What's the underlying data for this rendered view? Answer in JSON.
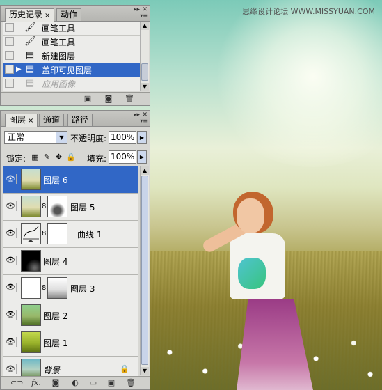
{
  "watermark": "思缘设计论坛 WWW.MISSYUAN.COM",
  "history_panel": {
    "tabs": [
      "历史记录",
      "动作"
    ],
    "close_glyph": "×",
    "items": [
      {
        "label": "画笔工具",
        "icon": "brush-icon",
        "state": "normal"
      },
      {
        "label": "画笔工具",
        "icon": "brush-icon",
        "state": "normal"
      },
      {
        "label": "新建图层",
        "icon": "document-icon",
        "state": "normal"
      },
      {
        "label": "盖印可见图层",
        "icon": "document-icon",
        "state": "selected"
      },
      {
        "label": "应用图像",
        "icon": "document-icon",
        "state": "dimmed"
      }
    ],
    "footer_icons": [
      "new-document-from-state-icon",
      "new-snapshot-icon",
      "trash-icon"
    ]
  },
  "layers_panel": {
    "tabs": [
      "图层",
      "通道",
      "路径"
    ],
    "blend_mode": "正常",
    "opacity_label": "不透明度:",
    "opacity_value": "100%",
    "lock_label": "锁定:",
    "fill_label": "填充:",
    "fill_value": "100%",
    "layers": [
      {
        "name": "图层 6",
        "selected": true,
        "thumb": "photo",
        "mask": null,
        "locked": false
      },
      {
        "name": "图层 5",
        "selected": false,
        "thumb": "photo",
        "mask": "gray-mask",
        "locked": false
      },
      {
        "name": "曲线 1",
        "selected": false,
        "thumb": "curves",
        "mask": "white-mask",
        "locked": false
      },
      {
        "name": "图层 4",
        "selected": false,
        "thumb": "black",
        "mask": null,
        "locked": false
      },
      {
        "name": "图层 3",
        "selected": false,
        "thumb": "white",
        "mask": "gray-mask",
        "locked": false
      },
      {
        "name": "图层 2",
        "selected": false,
        "thumb": "green-photo",
        "mask": null,
        "locked": false
      },
      {
        "name": "图层 1",
        "selected": false,
        "thumb": "yellow-green-photo",
        "mask": null,
        "locked": false
      },
      {
        "name": "背景",
        "selected": false,
        "thumb": "photo",
        "mask": null,
        "locked": true
      }
    ],
    "footer_icons": [
      "link-icon",
      "fx-icon",
      "mask-icon",
      "adjustment-icon",
      "folder-icon",
      "new-layer-icon",
      "trash-icon"
    ]
  }
}
